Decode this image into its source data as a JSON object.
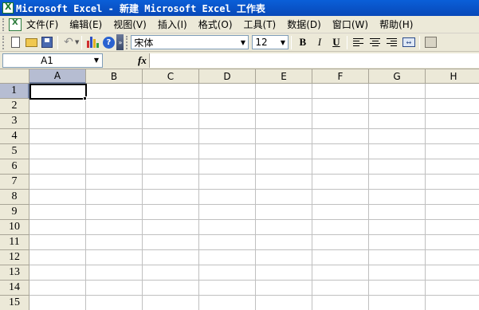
{
  "window": {
    "title": "Microsoft Excel - 新建 Microsoft Excel 工作表"
  },
  "menu": {
    "items": [
      {
        "label": "文件(F)"
      },
      {
        "label": "编辑(E)"
      },
      {
        "label": "视图(V)"
      },
      {
        "label": "插入(I)"
      },
      {
        "label": "格式(O)"
      },
      {
        "label": "工具(T)"
      },
      {
        "label": "数据(D)"
      },
      {
        "label": "窗口(W)"
      },
      {
        "label": "帮助(H)"
      }
    ]
  },
  "toolbar": {
    "font_name": "宋体",
    "font_size": "12",
    "bold_label": "B",
    "italic_label": "I",
    "underline_label": "U",
    "help_glyph": "?",
    "more_glyph": "»"
  },
  "formula_bar": {
    "name_box": "A1",
    "fx_label": "fx",
    "content": ""
  },
  "sheet": {
    "columns": [
      "A",
      "B",
      "C",
      "D",
      "E",
      "F",
      "G",
      "H"
    ],
    "rows": [
      "1",
      "2",
      "3",
      "4",
      "5",
      "6",
      "7",
      "8",
      "9",
      "10",
      "11",
      "12",
      "13",
      "14",
      "15"
    ],
    "active_cell": "A1"
  },
  "colors": {
    "titlebar": "#0a5fd8",
    "chrome": "#ece9d8",
    "header_active": "#b6bdd2",
    "gridline": "#c0c0c0"
  }
}
